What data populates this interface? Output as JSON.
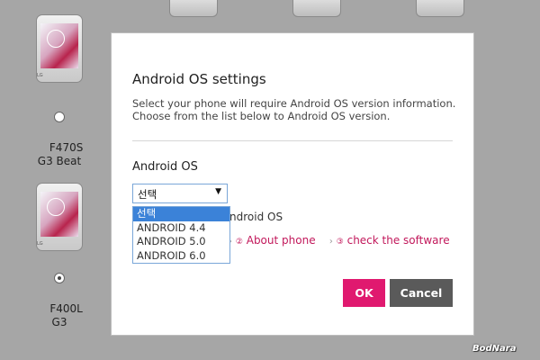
{
  "background_phones": [
    {
      "model": "F470S",
      "name": "G3 Beat",
      "selected": false
    },
    {
      "model": "F400L",
      "name": "G3",
      "selected": true
    }
  ],
  "dialog": {
    "title": "Android OS settings",
    "description_line1": "Select your phone will require Android OS version information.",
    "description_line2": "Choose from the list below to Android OS version.",
    "section_label": "Android OS",
    "select": {
      "value": "선택",
      "options": [
        "선택",
        "ANDROID 4.4",
        "ANDROID 5.0",
        "ANDROID 6.0"
      ],
      "highlighted_index": 0
    },
    "hint_fragment": "ndroid OS",
    "steps": {
      "step2_num": "②",
      "step2_label": "About phone",
      "step3_num": "③",
      "step3_label": "check the software",
      "arrow": "›"
    },
    "ok_label": "OK",
    "cancel_label": "Cancel"
  },
  "watermark": "BodNara",
  "colors": {
    "ok": "#e0196f",
    "cancel": "#5a5a5a",
    "link": "#c2185b",
    "highlight": "#3b82d8"
  }
}
